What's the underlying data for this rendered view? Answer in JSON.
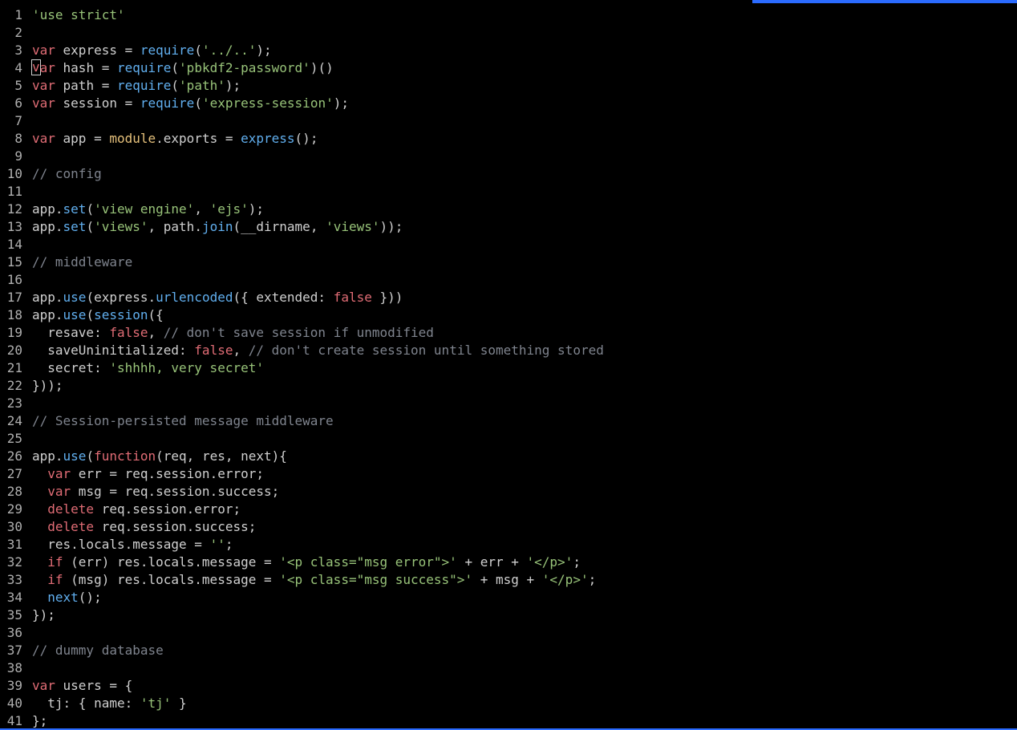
{
  "cursor": {
    "line": 4,
    "col": 1
  },
  "accent_color": "#2b6bff",
  "lines": [
    {
      "n": 1,
      "tokens": [
        {
          "t": "'use strict'",
          "c": "tok-str"
        }
      ]
    },
    {
      "n": 2,
      "tokens": []
    },
    {
      "n": 3,
      "tokens": [
        {
          "t": "var",
          "c": "tok-kw"
        },
        {
          "t": " express = ",
          "c": "tok-plain"
        },
        {
          "t": "require",
          "c": "tok-fn"
        },
        {
          "t": "(",
          "c": "tok-plain"
        },
        {
          "t": "'../..'",
          "c": "tok-str"
        },
        {
          "t": ");",
          "c": "tok-plain"
        }
      ]
    },
    {
      "n": 4,
      "tokens": [
        {
          "t": "var",
          "c": "tok-kw"
        },
        {
          "t": " hash = ",
          "c": "tok-plain"
        },
        {
          "t": "require",
          "c": "tok-fn"
        },
        {
          "t": "(",
          "c": "tok-plain"
        },
        {
          "t": "'pbkdf2-password'",
          "c": "tok-str"
        },
        {
          "t": ")()",
          "c": "tok-plain"
        }
      ]
    },
    {
      "n": 5,
      "tokens": [
        {
          "t": "var",
          "c": "tok-kw"
        },
        {
          "t": " path = ",
          "c": "tok-plain"
        },
        {
          "t": "require",
          "c": "tok-fn"
        },
        {
          "t": "(",
          "c": "tok-plain"
        },
        {
          "t": "'path'",
          "c": "tok-str"
        },
        {
          "t": ");",
          "c": "tok-plain"
        }
      ]
    },
    {
      "n": 6,
      "tokens": [
        {
          "t": "var",
          "c": "tok-kw"
        },
        {
          "t": " session = ",
          "c": "tok-plain"
        },
        {
          "t": "require",
          "c": "tok-fn"
        },
        {
          "t": "(",
          "c": "tok-plain"
        },
        {
          "t": "'express-session'",
          "c": "tok-str"
        },
        {
          "t": ");",
          "c": "tok-plain"
        }
      ]
    },
    {
      "n": 7,
      "tokens": []
    },
    {
      "n": 8,
      "tokens": [
        {
          "t": "var",
          "c": "tok-kw"
        },
        {
          "t": " app = ",
          "c": "tok-plain"
        },
        {
          "t": "module",
          "c": "tok-builtin"
        },
        {
          "t": ".exports = ",
          "c": "tok-plain"
        },
        {
          "t": "express",
          "c": "tok-fn"
        },
        {
          "t": "();",
          "c": "tok-plain"
        }
      ]
    },
    {
      "n": 9,
      "tokens": []
    },
    {
      "n": 10,
      "tokens": [
        {
          "t": "// config",
          "c": "tok-com"
        }
      ]
    },
    {
      "n": 11,
      "tokens": []
    },
    {
      "n": 12,
      "tokens": [
        {
          "t": "app.",
          "c": "tok-plain"
        },
        {
          "t": "set",
          "c": "tok-fn"
        },
        {
          "t": "(",
          "c": "tok-plain"
        },
        {
          "t": "'view engine'",
          "c": "tok-str"
        },
        {
          "t": ", ",
          "c": "tok-plain"
        },
        {
          "t": "'ejs'",
          "c": "tok-str"
        },
        {
          "t": ");",
          "c": "tok-plain"
        }
      ]
    },
    {
      "n": 13,
      "tokens": [
        {
          "t": "app.",
          "c": "tok-plain"
        },
        {
          "t": "set",
          "c": "tok-fn"
        },
        {
          "t": "(",
          "c": "tok-plain"
        },
        {
          "t": "'views'",
          "c": "tok-str"
        },
        {
          "t": ", path.",
          "c": "tok-plain"
        },
        {
          "t": "join",
          "c": "tok-fn"
        },
        {
          "t": "(__dirname, ",
          "c": "tok-plain"
        },
        {
          "t": "'views'",
          "c": "tok-str"
        },
        {
          "t": "));",
          "c": "tok-plain"
        }
      ]
    },
    {
      "n": 14,
      "tokens": []
    },
    {
      "n": 15,
      "tokens": [
        {
          "t": "// middleware",
          "c": "tok-com"
        }
      ]
    },
    {
      "n": 16,
      "tokens": []
    },
    {
      "n": 17,
      "tokens": [
        {
          "t": "app.",
          "c": "tok-plain"
        },
        {
          "t": "use",
          "c": "tok-fn"
        },
        {
          "t": "(express.",
          "c": "tok-plain"
        },
        {
          "t": "urlencoded",
          "c": "tok-fn"
        },
        {
          "t": "({ extended: ",
          "c": "tok-plain"
        },
        {
          "t": "false",
          "c": "tok-kw"
        },
        {
          "t": " }))",
          "c": "tok-plain"
        }
      ]
    },
    {
      "n": 18,
      "tokens": [
        {
          "t": "app.",
          "c": "tok-plain"
        },
        {
          "t": "use",
          "c": "tok-fn"
        },
        {
          "t": "(",
          "c": "tok-plain"
        },
        {
          "t": "session",
          "c": "tok-fn"
        },
        {
          "t": "({",
          "c": "tok-plain"
        }
      ]
    },
    {
      "n": 19,
      "tokens": [
        {
          "t": "  resave: ",
          "c": "tok-plain"
        },
        {
          "t": "false",
          "c": "tok-kw"
        },
        {
          "t": ", ",
          "c": "tok-plain"
        },
        {
          "t": "// don't save session if unmodified",
          "c": "tok-com"
        }
      ]
    },
    {
      "n": 20,
      "tokens": [
        {
          "t": "  saveUninitialized: ",
          "c": "tok-plain"
        },
        {
          "t": "false",
          "c": "tok-kw"
        },
        {
          "t": ", ",
          "c": "tok-plain"
        },
        {
          "t": "// don't create session until something stored",
          "c": "tok-com"
        }
      ]
    },
    {
      "n": 21,
      "tokens": [
        {
          "t": "  secret: ",
          "c": "tok-plain"
        },
        {
          "t": "'shhhh, very secret'",
          "c": "tok-str"
        }
      ]
    },
    {
      "n": 22,
      "tokens": [
        {
          "t": "}));",
          "c": "tok-plain"
        }
      ]
    },
    {
      "n": 23,
      "tokens": []
    },
    {
      "n": 24,
      "tokens": [
        {
          "t": "// Session-persisted message middleware",
          "c": "tok-com"
        }
      ]
    },
    {
      "n": 25,
      "tokens": []
    },
    {
      "n": 26,
      "tokens": [
        {
          "t": "app.",
          "c": "tok-plain"
        },
        {
          "t": "use",
          "c": "tok-fn"
        },
        {
          "t": "(",
          "c": "tok-plain"
        },
        {
          "t": "function",
          "c": "tok-kw"
        },
        {
          "t": "(req, res, next){",
          "c": "tok-plain"
        }
      ]
    },
    {
      "n": 27,
      "tokens": [
        {
          "t": "  ",
          "c": "tok-plain"
        },
        {
          "t": "var",
          "c": "tok-kw"
        },
        {
          "t": " err = req.session.error;",
          "c": "tok-plain"
        }
      ]
    },
    {
      "n": 28,
      "tokens": [
        {
          "t": "  ",
          "c": "tok-plain"
        },
        {
          "t": "var",
          "c": "tok-kw"
        },
        {
          "t": " msg = req.session.success;",
          "c": "tok-plain"
        }
      ]
    },
    {
      "n": 29,
      "tokens": [
        {
          "t": "  ",
          "c": "tok-plain"
        },
        {
          "t": "delete",
          "c": "tok-kw"
        },
        {
          "t": " req.session.error;",
          "c": "tok-plain"
        }
      ]
    },
    {
      "n": 30,
      "tokens": [
        {
          "t": "  ",
          "c": "tok-plain"
        },
        {
          "t": "delete",
          "c": "tok-kw"
        },
        {
          "t": " req.session.success;",
          "c": "tok-plain"
        }
      ]
    },
    {
      "n": 31,
      "tokens": [
        {
          "t": "  res.locals.message = ",
          "c": "tok-plain"
        },
        {
          "t": "''",
          "c": "tok-str"
        },
        {
          "t": ";",
          "c": "tok-plain"
        }
      ]
    },
    {
      "n": 32,
      "tokens": [
        {
          "t": "  ",
          "c": "tok-plain"
        },
        {
          "t": "if",
          "c": "tok-kw"
        },
        {
          "t": " (err) res.locals.message = ",
          "c": "tok-plain"
        },
        {
          "t": "'<p class=\"msg error\">'",
          "c": "tok-str"
        },
        {
          "t": " + err + ",
          "c": "tok-plain"
        },
        {
          "t": "'</p>'",
          "c": "tok-str"
        },
        {
          "t": ";",
          "c": "tok-plain"
        }
      ]
    },
    {
      "n": 33,
      "tokens": [
        {
          "t": "  ",
          "c": "tok-plain"
        },
        {
          "t": "if",
          "c": "tok-kw"
        },
        {
          "t": " (msg) res.locals.message = ",
          "c": "tok-plain"
        },
        {
          "t": "'<p class=\"msg success\">'",
          "c": "tok-str"
        },
        {
          "t": " + msg + ",
          "c": "tok-plain"
        },
        {
          "t": "'</p>'",
          "c": "tok-str"
        },
        {
          "t": ";",
          "c": "tok-plain"
        }
      ]
    },
    {
      "n": 34,
      "tokens": [
        {
          "t": "  ",
          "c": "tok-plain"
        },
        {
          "t": "next",
          "c": "tok-fn"
        },
        {
          "t": "();",
          "c": "tok-plain"
        }
      ]
    },
    {
      "n": 35,
      "tokens": [
        {
          "t": "});",
          "c": "tok-plain"
        }
      ]
    },
    {
      "n": 36,
      "tokens": []
    },
    {
      "n": 37,
      "tokens": [
        {
          "t": "// dummy database",
          "c": "tok-com"
        }
      ]
    },
    {
      "n": 38,
      "tokens": []
    },
    {
      "n": 39,
      "tokens": [
        {
          "t": "var",
          "c": "tok-kw"
        },
        {
          "t": " users = {",
          "c": "tok-plain"
        }
      ]
    },
    {
      "n": 40,
      "tokens": [
        {
          "t": "  tj: { name: ",
          "c": "tok-plain"
        },
        {
          "t": "'tj'",
          "c": "tok-str"
        },
        {
          "t": " }",
          "c": "tok-plain"
        }
      ]
    },
    {
      "n": 41,
      "tokens": [
        {
          "t": "};",
          "c": "tok-plain"
        }
      ]
    }
  ]
}
